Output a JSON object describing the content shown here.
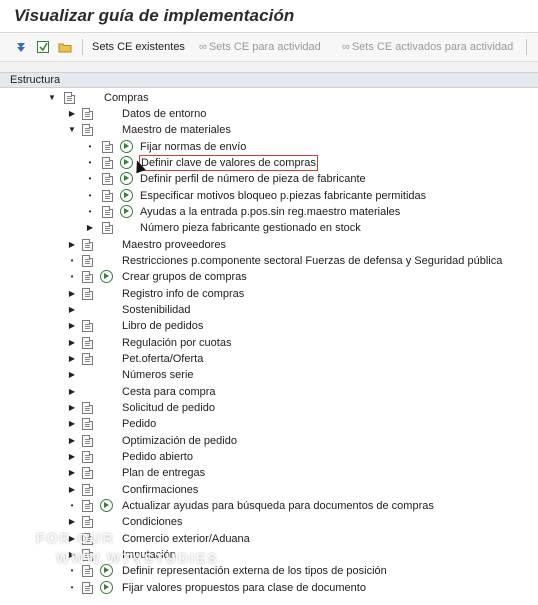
{
  "window": {
    "title": "Visualizar guía de implementación"
  },
  "toolbar": {
    "sets_existentes": "Sets CE existentes",
    "sets_para_actividad": "Sets CE para actividad",
    "sets_activados": "Sets CE activados para actividad"
  },
  "tree": {
    "column_header": "Estructura",
    "root": "Compras",
    "items": [
      "Datos de entorno",
      "Maestro de materiales",
      "Fijar normas de envío",
      "Definir clave de valores de compras",
      "Definir perfil de número de pieza de fabricante",
      "Especificar motivos bloqueo p.piezas fabricante permitidas",
      "Ayudas a la entrada p.pos.sin reg.maestro materiales",
      "Número pieza fabricante gestionado en stock",
      "Maestro proveedores",
      "Restricciones p.componente sectoral Fuerzas de defensa y Seguridad pública",
      "Crear grupos de compras",
      "Registro info de compras",
      "Sostenibilidad",
      "Libro de pedidos",
      "Regulación por cuotas",
      "Pet.oferta/Oferta",
      "Números serie",
      "Cesta para compra",
      "Solicitud de pedido",
      "Pedido",
      "Optimización de pedido",
      "Pedido abierto",
      "Plan de entregas",
      "Confirmaciones",
      "Actualizar ayudas para búsqueda para documentos de compras",
      "Condiciones",
      "Comercio exterior/Aduana",
      "Imputación",
      "Definir representación externa de los tipos de posición",
      "Fijar valores propuestos para clase de documento"
    ]
  },
  "watermark": {
    "line1": "FOR OUR",
    "line2": "WWW.WTVSTUDIES"
  },
  "colors": {
    "selection_outline": "#d23c3c",
    "exec_icon": "#3c7d3c",
    "header_bg": "#e3e9ef"
  }
}
